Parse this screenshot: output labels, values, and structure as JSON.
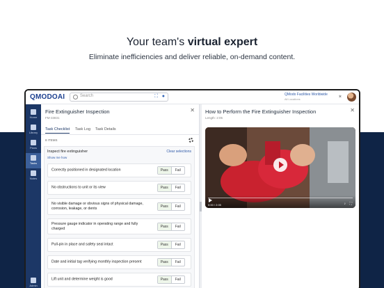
{
  "hero": {
    "title_pre": "Your team's",
    "title_bold": "virtual expert",
    "subtitle": "Eliminate inefficiencies and deliver reliable, on-demand content."
  },
  "topbar": {
    "logo": "QMODO",
    "logo_ai": "AI",
    "search_placeholder": "Search",
    "org_name": "QModo Facilities Worldwide",
    "org_sub": "All Locations"
  },
  "sidebar": {
    "items": [
      {
        "label": "Home",
        "icon": "home-icon"
      },
      {
        "label": "Library",
        "icon": "library-icon"
      },
      {
        "label": "Plans",
        "icon": "plans-icon"
      },
      {
        "label": "Tasks",
        "icon": "tasks-icon"
      },
      {
        "label": "Notes",
        "icon": "notes-icon"
      },
      {
        "label": "Admin",
        "icon": "admin-icon"
      }
    ],
    "active": "Tasks"
  },
  "task": {
    "title": "Fire Extinguisher Inspection",
    "id": "FM-33831",
    "tabs": [
      "Task Checklist",
      "Task Log",
      "Task Details"
    ],
    "items_count": "8 ITEMS",
    "section": "Inspect fire extinguisher",
    "show_me_how": "Show me how",
    "clear": "Clear selections",
    "pass": "Pass",
    "fail": "Fail",
    "checklist": [
      "Correctly positioned in designated location",
      "No obstructions to unit or its view",
      "No visible damage or obvious signs of physical damage, corrosion, leakage, or dents",
      "Pressure gauge indicator in operating range and fully charged",
      "Pull-pin in place and safety seal intact",
      "Date and initial tag verifying monthly inspection present",
      "Lift unit and determine weight is good"
    ]
  },
  "video": {
    "title": "How to Perform the Fire Extinguisher Inspection",
    "length": "Length: 2:05",
    "time": "0:00 / 2:05"
  },
  "colors": {
    "navy": "#0f2446",
    "sidebar": "#1c3766",
    "link": "#2f5aa8"
  }
}
